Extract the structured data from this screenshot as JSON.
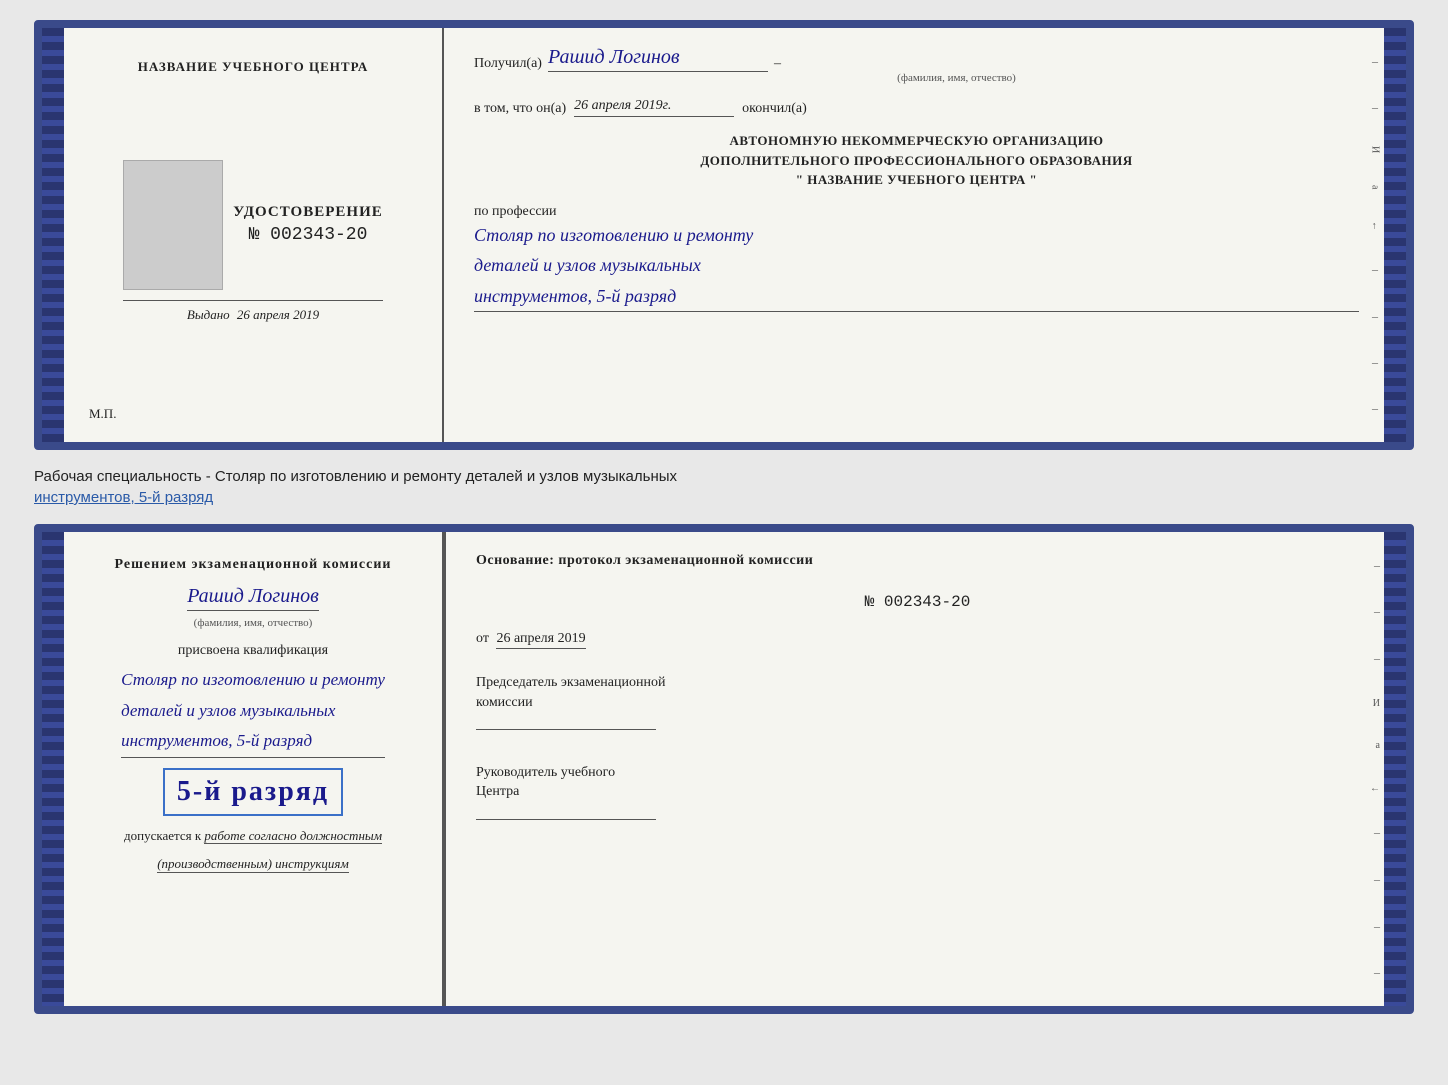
{
  "top_cert": {
    "left": {
      "header": "НАЗВАНИЕ УЧЕБНОГО ЦЕНТРА",
      "photo_alt": "фото",
      "title": "УДОСТОВЕРЕНИЕ",
      "number": "№ 002343-20",
      "issued_label": "Выдано",
      "issued_date": "26 апреля 2019",
      "mp": "М.П."
    },
    "right": {
      "received_label": "Получил(а)",
      "received_name": "Рашид Логинов",
      "fio_label": "(фамилия, имя, отчество)",
      "dash": "–",
      "confirm_label": "в том, что он(а)",
      "confirm_date": "26 апреля 2019г.",
      "confirm_end": "окончил(а)",
      "org_line1": "АВТОНОМНУЮ НЕКОММЕРЧЕСКУЮ ОРГАНИЗАЦИЮ",
      "org_line2": "ДОПОЛНИТЕЛЬНОГО ПРОФЕССИОНАЛЬНОГО ОБРАЗОВАНИЯ",
      "org_line3": "\"  НАЗВАНИЕ УЧЕБНОГО ЦЕНТРА  \"",
      "profession_label": "по профессии",
      "profession_line1": "Столяр по изготовлению и ремонту",
      "profession_line2": "деталей и узлов музыкальных",
      "profession_line3": "инструментов, 5-й разряд"
    }
  },
  "between_text": {
    "line1": "Рабочая специальность - Столяр по изготовлению и ремонту деталей и узлов музыкальных",
    "line2": "инструментов, 5-й разряд"
  },
  "bottom_cert": {
    "left": {
      "decision_line1": "Решением экзаменационной комиссии",
      "decision_name": "Рашид Логинов",
      "fio_label": "(фамилия, имя, отчество)",
      "assigned_label": "присвоена квалификация",
      "qual_line1": "Столяр по изготовлению и ремонту",
      "qual_line2": "деталей и узлов музыкальных",
      "qual_line3": "инструментов, 5-й разряд",
      "rank_text": "5-й разряд",
      "допускается_label": "допускается к",
      "допускается_italic": "работе согласно должностным",
      "допускается_italic2": "(производственным) инструкциям"
    },
    "right": {
      "osnov_label": "Основание: протокол экзаменационной  комиссии",
      "osnov_number": "№  002343-20",
      "ot_label": "от",
      "ot_date": "26 апреля 2019",
      "chairman_label": "Председатель экзаменационной",
      "chairman_label2": "комиссии",
      "руководитель_label": "Руководитель учебного",
      "руководитель_label2": "Центра"
    }
  }
}
